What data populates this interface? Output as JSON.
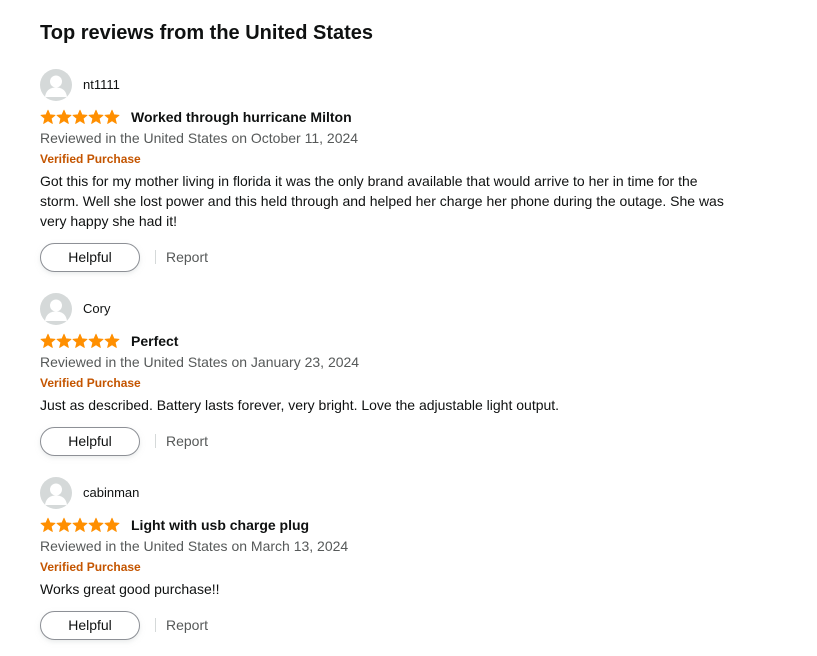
{
  "section": {
    "title": "Top reviews from the United States"
  },
  "colors": {
    "star": "#ff8f00",
    "verified": "#c45500",
    "muted_text": "#565959",
    "text": "#0f1111"
  },
  "reviews": [
    {
      "author": "nt1111",
      "rating": 5,
      "title": "Worked through hurricane Milton",
      "date": "Reviewed in the United States on October 11, 2024",
      "verified": "Verified Purchase",
      "body": "Got this for my mother living in florida it was the only brand available that would arrive to her in time for the storm. Well she lost power and this held through and helped her charge her phone during the outage. She was very happy she had it!",
      "helpful_label": "Helpful",
      "report_label": "Report"
    },
    {
      "author": "Cory",
      "rating": 5,
      "title": "Perfect",
      "date": "Reviewed in the United States on January 23, 2024",
      "verified": "Verified Purchase",
      "body": "Just as described. Battery lasts forever, very bright. Love the adjustable light output.",
      "helpful_label": "Helpful",
      "report_label": "Report"
    },
    {
      "author": "cabinman",
      "rating": 5,
      "title": "Light with usb charge plug",
      "date": "Reviewed in the United States on March 13, 2024",
      "verified": "Verified Purchase",
      "body": "Works great good purchase!!",
      "helpful_label": "Helpful",
      "report_label": "Report"
    }
  ]
}
